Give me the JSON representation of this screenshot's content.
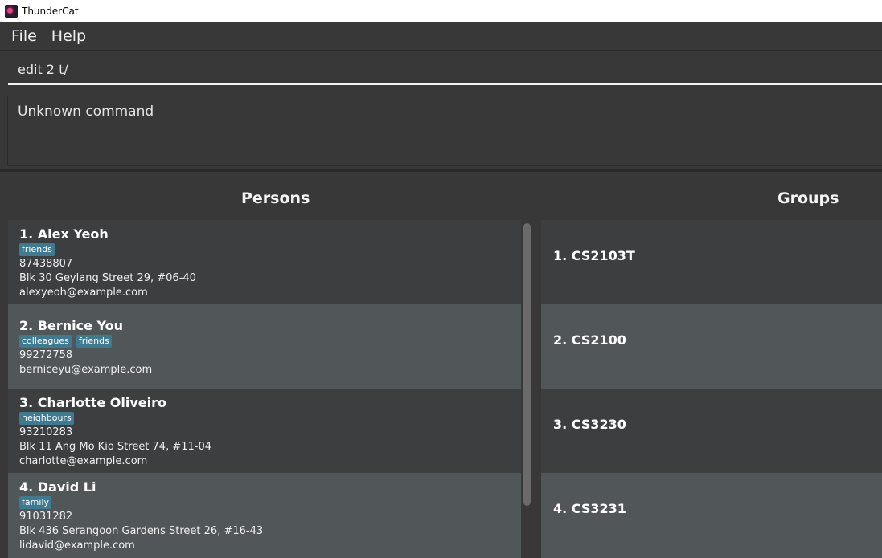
{
  "window": {
    "title": "ThunderCat"
  },
  "menu": {
    "file": "File",
    "help": "Help"
  },
  "command": {
    "value": "edit 2 t/"
  },
  "result": {
    "text": "Unknown command"
  },
  "panels": {
    "persons_title": "Persons",
    "groups_title": "Groups"
  },
  "persons": [
    {
      "index": "1. ",
      "name": "Alex Yeoh",
      "tags": [
        "friends"
      ],
      "phone": "87438807",
      "address": "Blk 30 Geylang Street 29, #06-40",
      "email": "alexyeoh@example.com"
    },
    {
      "index": "2. ",
      "name": "Bernice You",
      "tags": [
        "colleagues",
        "friends"
      ],
      "phone": "99272758",
      "address": "",
      "email": "berniceyu@example.com"
    },
    {
      "index": "3. ",
      "name": "Charlotte Oliveiro",
      "tags": [
        "neighbours"
      ],
      "phone": "93210283",
      "address": "Blk 11 Ang Mo Kio Street 74, #11-04",
      "email": "charlotte@example.com"
    },
    {
      "index": "4. ",
      "name": "David Li",
      "tags": [
        "family"
      ],
      "phone": "91031282",
      "address": "Blk 436 Serangoon Gardens Street 26, #16-43",
      "email": "lidavid@example.com"
    }
  ],
  "groups": [
    {
      "index": "1. ",
      "name": "CS2103T"
    },
    {
      "index": "2. ",
      "name": "CS2100"
    },
    {
      "index": "3. ",
      "name": "CS3230"
    },
    {
      "index": "4. ",
      "name": "CS3231"
    }
  ],
  "colors": {
    "background": "#383838",
    "card_odd": "#3c3e3f",
    "card_even": "#515658",
    "tag": "#3e7b91"
  }
}
